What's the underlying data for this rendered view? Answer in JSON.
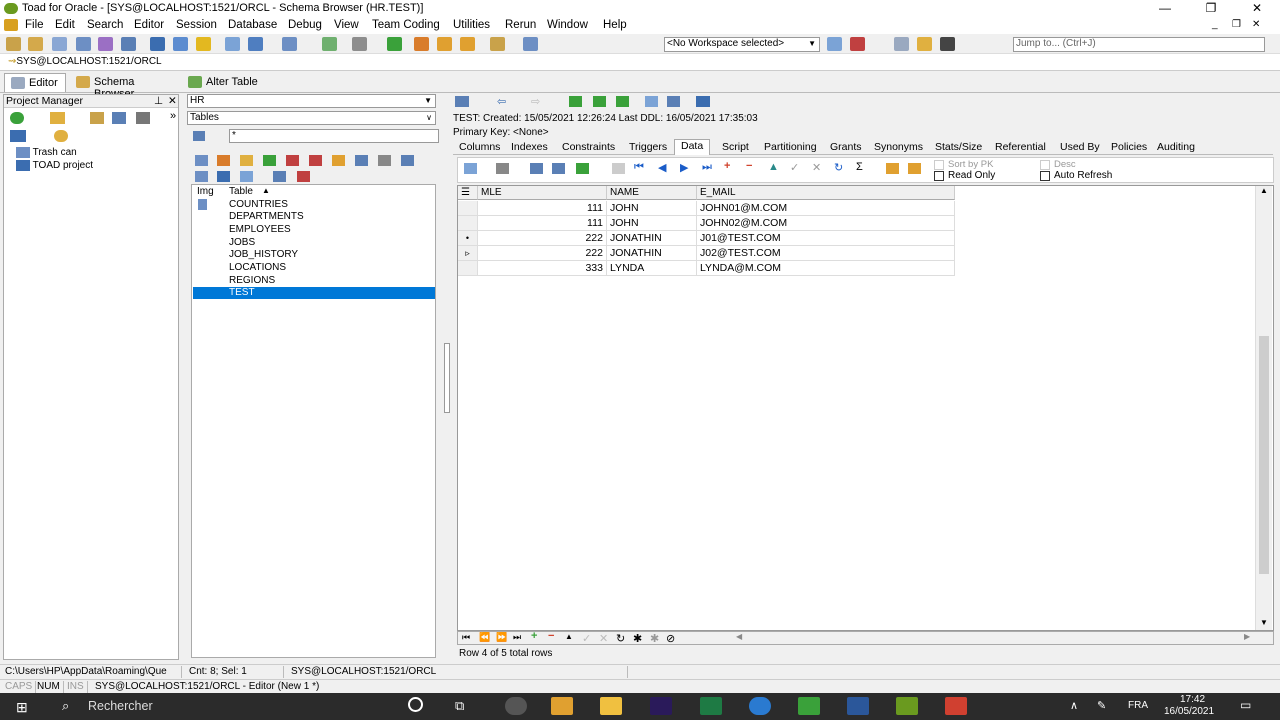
{
  "window": {
    "title": "Toad for Oracle - [SYS@LOCALHOST:1521/ORCL - Schema Browser (HR.TEST)]"
  },
  "menu": [
    "File",
    "Edit",
    "Search",
    "Editor",
    "Session",
    "Database",
    "Debug",
    "View",
    "Team Coding",
    "Utilities",
    "Rerun",
    "Window",
    "Help"
  ],
  "toolbar": {
    "workspace": "<No Workspace selected>",
    "jump_placeholder": "Jump to... (Ctrl+J)"
  },
  "connection": "SYS@LOCALHOST:1521/ORCL",
  "doc_tabs": [
    "Editor",
    "Schema Browser",
    "Alter Table"
  ],
  "project_manager": {
    "title": "Project Manager",
    "items": [
      "Trash can",
      "TOAD project"
    ]
  },
  "schema": {
    "owner": "HR",
    "object_type": "Tables",
    "filter": "*",
    "col_img": "Img",
    "col_table": "Table",
    "tables": [
      "COUNTRIES",
      "DEPARTMENTS",
      "EMPLOYEES",
      "JOBS",
      "JOB_HISTORY",
      "LOCATIONS",
      "REGIONS",
      "TEST"
    ]
  },
  "details": {
    "line1": "TEST:  Created: 15/05/2021 12:26:24   Last DDL: 16/05/2021 17:35:03",
    "line2": "Primary Key:  <None>",
    "tabs": [
      "Columns",
      "Indexes",
      "Constraints",
      "Triggers",
      "Data",
      "Script",
      "Partitioning",
      "Grants",
      "Synonyms",
      "Stats/Size",
      "Referential",
      "Used By",
      "Policies",
      "Auditing"
    ],
    "active_tab": "Data",
    "options": {
      "sort_by_pk": "Sort by PK",
      "desc": "Desc",
      "read_only": "Read Only",
      "auto_refresh": "Auto Refresh"
    }
  },
  "grid": {
    "columns": [
      "MLE",
      "NAME",
      "E_MAIL"
    ],
    "rows": [
      {
        "marker": "",
        "mle": "111",
        "name": "JOHN",
        "email": "JOHN01@M.COM"
      },
      {
        "marker": "",
        "mle": "111",
        "name": "JOHN",
        "email": "JOHN02@M.COM"
      },
      {
        "marker": "•",
        "mle": "222",
        "name": "JONATHIN",
        "email": "J01@TEST.COM"
      },
      {
        "marker": "▹",
        "mle": "222",
        "name": "JONATHIN",
        "email": "J02@TEST.COM"
      },
      {
        "marker": "",
        "mle": "333",
        "name": "LYNDA",
        "email": "LYNDA@M.COM"
      }
    ],
    "footer": "Row 4 of 5 total rows"
  },
  "status": {
    "path": "C:\\Users\\HP\\AppData\\Roaming\\Que",
    "cnt": "Cnt: 8; Sel: 1",
    "conn": "SYS@LOCALHOST:1521/ORCL",
    "caps": "CAPS",
    "num": "NUM",
    "ins": "INS",
    "editor": "SYS@LOCALHOST:1521/ORCL - Editor (New 1 *)"
  },
  "taskbar": {
    "search": "Rechercher",
    "lang": "FRA",
    "time": "17:42",
    "date": "16/05/2021"
  }
}
